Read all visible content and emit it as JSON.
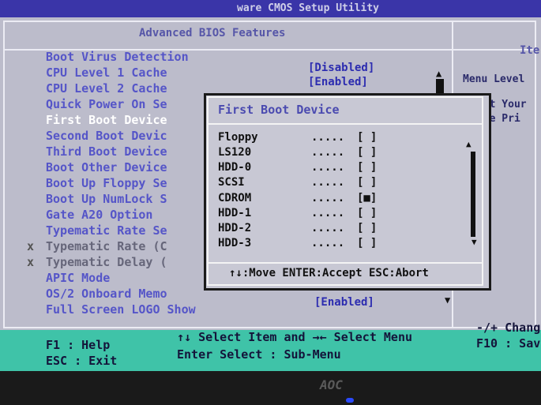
{
  "top_strip": "ware CMOS Setup Utility",
  "header": {
    "title": "Advanced BIOS Features",
    "help_title": "Ite"
  },
  "help": {
    "line1": "Menu Level",
    "line2": "ect Your",
    "line3": "ice Pri"
  },
  "items": [
    {
      "label": "Boot Virus Detection",
      "state": "normal"
    },
    {
      "label": "CPU Level 1 Cache",
      "state": "normal"
    },
    {
      "label": "CPU Level 2 Cache",
      "state": "normal"
    },
    {
      "label": "Quick Power On Se",
      "state": "normal"
    },
    {
      "label": "First Boot Device",
      "state": "selected"
    },
    {
      "label": "Second Boot Devic",
      "state": "normal"
    },
    {
      "label": "Third Boot Device",
      "state": "normal"
    },
    {
      "label": "Boot Other Device",
      "state": "normal"
    },
    {
      "label": "Boot Up Floppy Se",
      "state": "normal"
    },
    {
      "label": "Boot Up NumLock S",
      "state": "normal"
    },
    {
      "label": "Gate A20 Option",
      "state": "normal"
    },
    {
      "label": "Typematic Rate Se",
      "state": "normal"
    },
    {
      "label": "Typematic Rate (C",
      "state": "disabled"
    },
    {
      "label": "Typematic Delay (",
      "state": "disabled"
    },
    {
      "label": "APIC Mode",
      "state": "normal"
    },
    {
      "label": "OS/2 Onboard Memo",
      "state": "normal"
    },
    {
      "label": "Full Screen LOGO Show",
      "state": "normal"
    }
  ],
  "values": {
    "v0": "[Disabled]",
    "v1": "[Enabled]",
    "v16": "[Enabled]"
  },
  "x_mark": "x",
  "popup": {
    "title": "First Boot Device",
    "options": [
      {
        "label": "Floppy",
        "dots": ".....",
        "box": "[ ]"
      },
      {
        "label": "LS120",
        "dots": ".....",
        "box": "[ ]"
      },
      {
        "label": "HDD-0",
        "dots": ".....",
        "box": "[ ]"
      },
      {
        "label": "SCSI",
        "dots": ".....",
        "box": "[ ]"
      },
      {
        "label": "CDROM",
        "dots": ".....",
        "box": "[■]"
      },
      {
        "label": "HDD-1",
        "dots": ".....",
        "box": "[ ]"
      },
      {
        "label": "HDD-2",
        "dots": ".....",
        "box": "[ ]"
      },
      {
        "label": "HDD-3",
        "dots": ".....",
        "box": "[ ]"
      }
    ],
    "hint": "↑↓:Move ENTER:Accept ESC:Abort"
  },
  "bottom": {
    "f1": "F1  : Help",
    "esc": "ESC : Exit",
    "sel_item": "↑↓ Select Item and →← Select Menu",
    "enter": "Enter Select : Sub-Menu",
    "change": "-/+ Chang",
    "f10": "F10 : Sav"
  },
  "bezel": {
    "logo": "AOC"
  },
  "icons": {
    "up": "arrow-up-icon",
    "down": "arrow-down-icon"
  }
}
